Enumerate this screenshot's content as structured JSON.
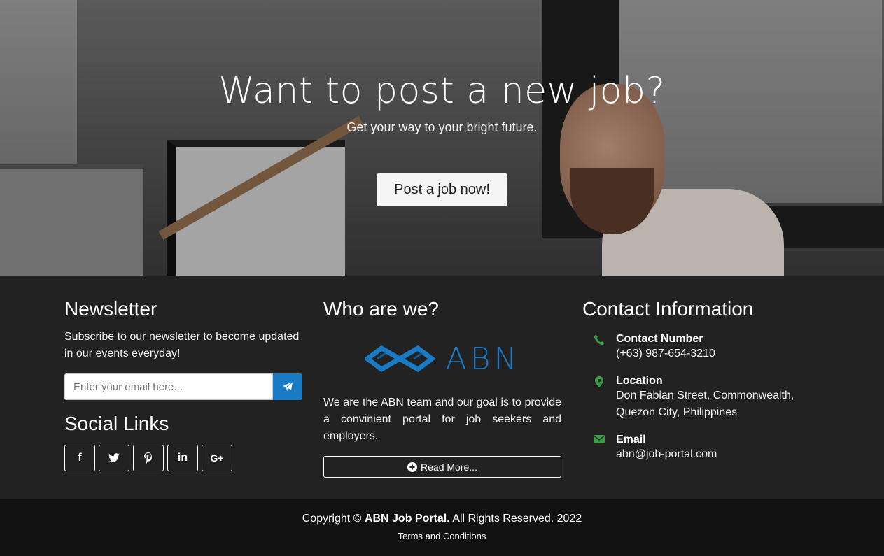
{
  "hero": {
    "title": "Want to post a new job?",
    "subtitle": "Get your way to your bright future.",
    "button_label": "Post a job now!"
  },
  "newsletter": {
    "title": "Newsletter",
    "text": "Subscribe to our newsletter to become updated in our events everyday!",
    "email_placeholder": "Enter your email here...",
    "send_icon": "paper-plane-icon"
  },
  "social": {
    "title": "Social Links",
    "items": [
      {
        "icon": "facebook-icon",
        "glyph": "f"
      },
      {
        "icon": "twitter-icon",
        "glyph": "t"
      },
      {
        "icon": "pinterest-icon",
        "glyph": "p"
      },
      {
        "icon": "linkedin-icon",
        "glyph": "in"
      },
      {
        "icon": "google-plus-icon",
        "glyph": "G+"
      }
    ]
  },
  "about": {
    "title": "Who are we?",
    "logo_text": "ABN",
    "text": "We are the ABN team and our goal is to provide a convinient portal for job seekers and employers.",
    "read_more_label": "Read More..."
  },
  "contact": {
    "title": "Contact Information",
    "items": [
      {
        "icon": "phone-icon",
        "label": "Contact Number",
        "value": "(+63) 987-654-3210"
      },
      {
        "icon": "location-pin-icon",
        "label": "Location",
        "value": "Don Fabian Street, Commonwealth, Quezon City, Philippines"
      },
      {
        "icon": "envelope-icon",
        "label": "Email",
        "value": "abn@job-portal.com"
      }
    ]
  },
  "footer": {
    "copyright_prefix": "Copyright ©",
    "brand": "ABN Job Portal.",
    "copyright_suffix": "All Rights Reserved. 2022",
    "terms_label": "Terms and Conditions"
  },
  "colors": {
    "accent": "#1a7bc4",
    "contact_icon": "#3c9d48",
    "footer_bg": "#222222",
    "copyright_bg": "#111111"
  }
}
